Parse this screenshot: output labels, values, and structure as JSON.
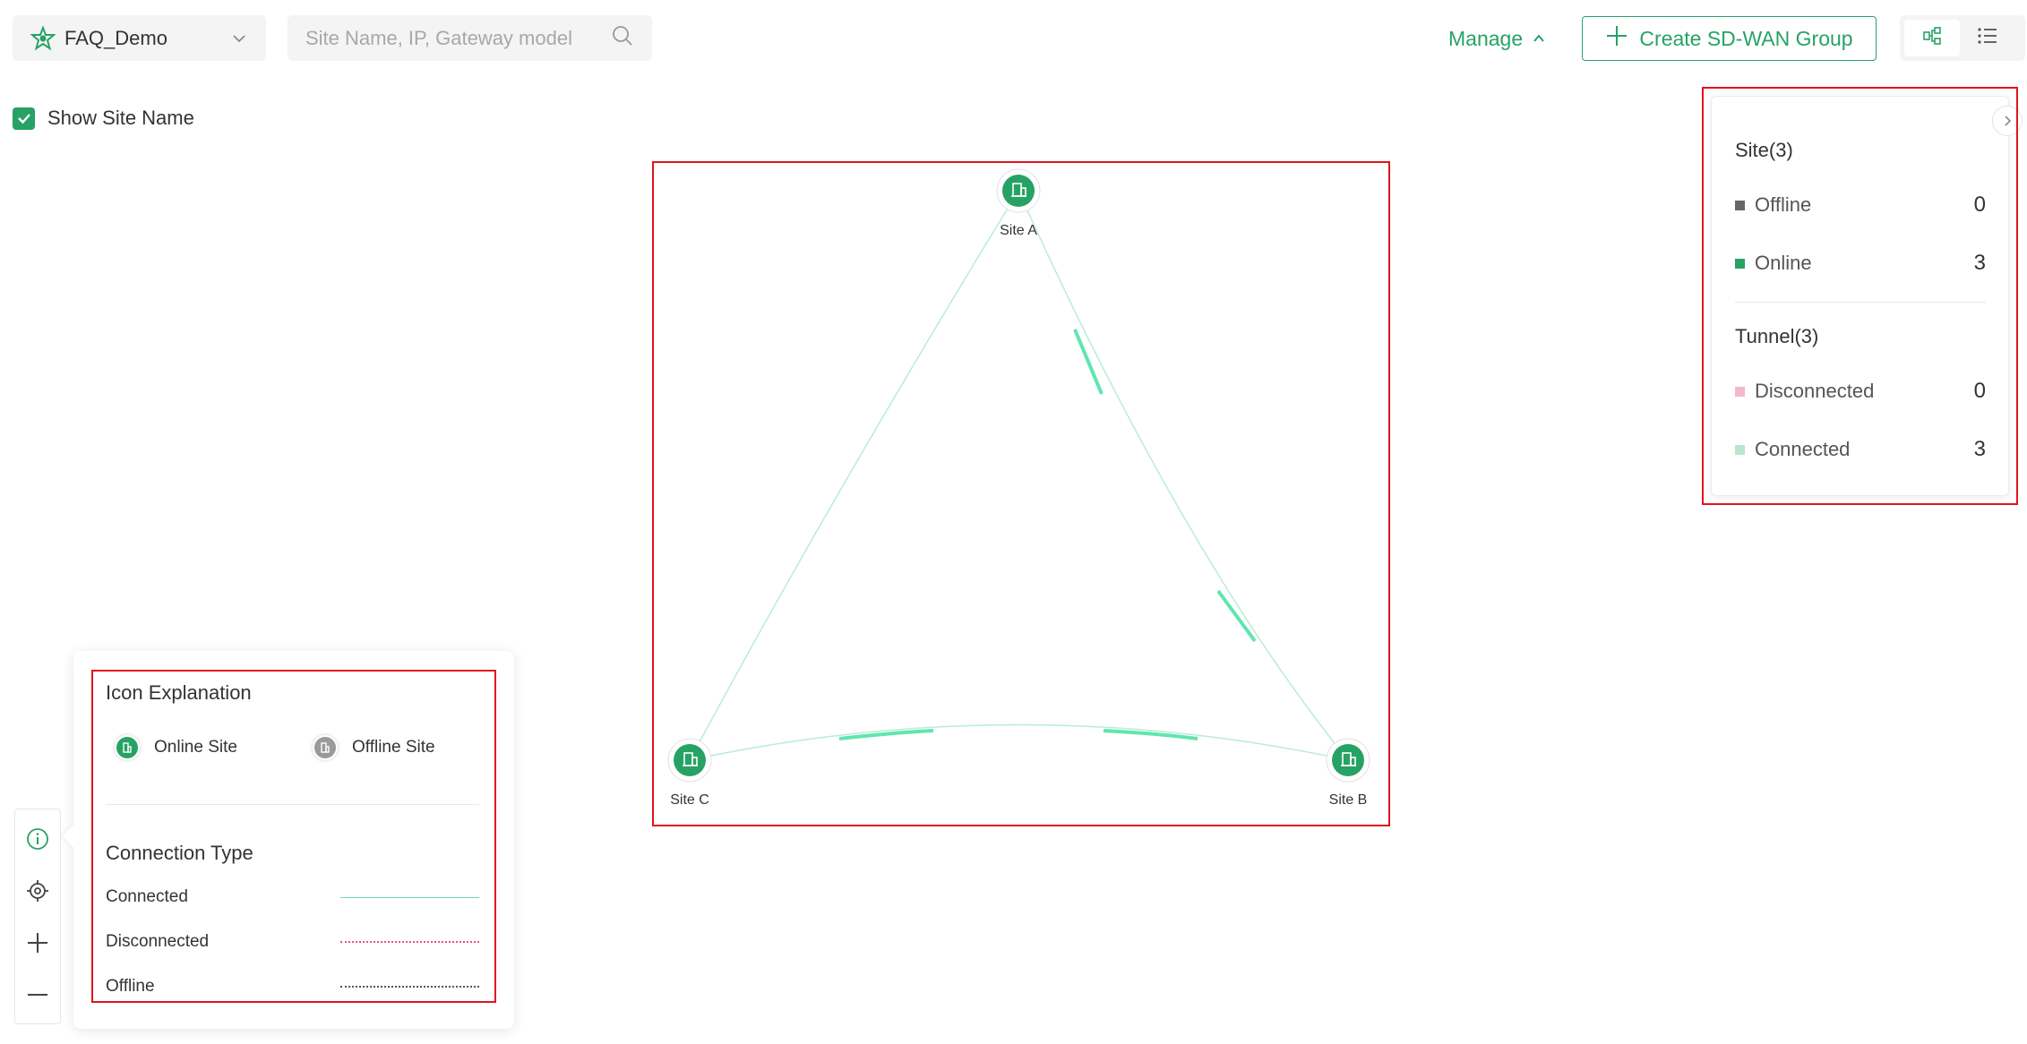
{
  "header": {
    "org_name": "FAQ_Demo",
    "search_placeholder": "Site Name, IP, Gateway model",
    "manage_label": "Manage",
    "create_label": "Create SD-WAN Group"
  },
  "options": {
    "show_site_name_label": "Show Site Name",
    "show_site_name_checked": true
  },
  "topology": {
    "sites": [
      {
        "name": "Site A",
        "status": "online"
      },
      {
        "name": "Site B",
        "status": "online"
      },
      {
        "name": "Site C",
        "status": "online"
      }
    ],
    "tunnels": [
      {
        "from": "Site A",
        "to": "Site B",
        "status": "connected"
      },
      {
        "from": "Site B",
        "to": "Site C",
        "status": "connected"
      },
      {
        "from": "Site C",
        "to": "Site A",
        "status": "connected"
      }
    ]
  },
  "summary": {
    "site_heading": "Site(3)",
    "tunnel_heading": "Tunnel(3)",
    "rows": [
      {
        "label": "Offline",
        "count": "0",
        "color": "#666666"
      },
      {
        "label": "Online",
        "count": "3",
        "color": "#27a265"
      },
      {
        "label": "Disconnected",
        "count": "0",
        "color": "#f4b8c8"
      },
      {
        "label": "Connected",
        "count": "3",
        "color": "#b9e6cf"
      }
    ]
  },
  "legend": {
    "icon_heading": "Icon Explanation",
    "online_site": "Online Site",
    "offline_site": "Offline Site",
    "conn_heading": "Connection Type",
    "connections": [
      {
        "label": "Connected",
        "style": "solid",
        "color": "#6fd9b0"
      },
      {
        "label": "Disconnected",
        "style": "dotted",
        "color": "#e8508a"
      },
      {
        "label": "Offline",
        "style": "dotted",
        "color": "#555555"
      }
    ]
  },
  "tools": [
    "info-icon",
    "locate-icon",
    "zoom-in-icon",
    "zoom-out-icon"
  ],
  "colors": {
    "accent": "#27a265",
    "highlight_frame": "#e0141e"
  }
}
